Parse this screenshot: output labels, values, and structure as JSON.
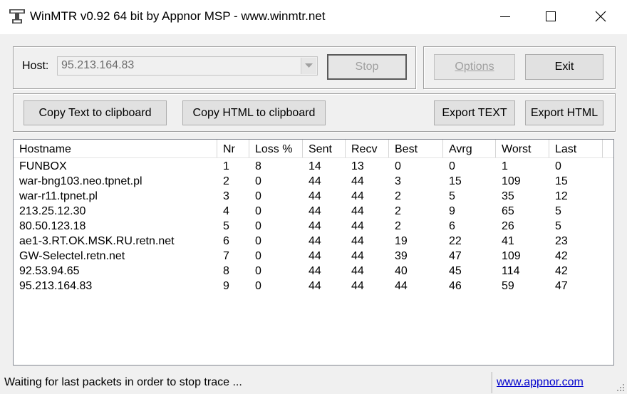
{
  "window": {
    "title": "WinMTR v0.92 64 bit by Appnor MSP - www.winmtr.net",
    "icon": "winmtr-app-icon"
  },
  "host": {
    "label": "Host:",
    "value": "95.213.164.83"
  },
  "buttons": {
    "stop": "Stop",
    "options": "Options",
    "exit": "Exit",
    "copy_text": "Copy Text to clipboard",
    "copy_html": "Copy HTML to clipboard",
    "export_text": "Export TEXT",
    "export_html": "Export HTML"
  },
  "table": {
    "columns": [
      "Hostname",
      "Nr",
      "Loss %",
      "Sent",
      "Recv",
      "Best",
      "Avrg",
      "Worst",
      "Last"
    ],
    "rows": [
      [
        "FUNBOX",
        "1",
        "8",
        "14",
        "13",
        "0",
        "0",
        "1",
        "0"
      ],
      [
        "war-bng103.neo.tpnet.pl",
        "2",
        "0",
        "44",
        "44",
        "3",
        "15",
        "109",
        "15"
      ],
      [
        "war-r11.tpnet.pl",
        "3",
        "0",
        "44",
        "44",
        "2",
        "5",
        "35",
        "12"
      ],
      [
        "213.25.12.30",
        "4",
        "0",
        "44",
        "44",
        "2",
        "9",
        "65",
        "5"
      ],
      [
        "80.50.123.18",
        "5",
        "0",
        "44",
        "44",
        "2",
        "6",
        "26",
        "5"
      ],
      [
        "ae1-3.RT.OK.MSK.RU.retn.net",
        "6",
        "0",
        "44",
        "44",
        "19",
        "22",
        "41",
        "23"
      ],
      [
        "GW-Selectel.retn.net",
        "7",
        "0",
        "44",
        "44",
        "39",
        "47",
        "109",
        "42"
      ],
      [
        "92.53.94.65",
        "8",
        "0",
        "44",
        "44",
        "40",
        "45",
        "114",
        "42"
      ],
      [
        "95.213.164.83",
        "9",
        "0",
        "44",
        "44",
        "44",
        "46",
        "59",
        "47"
      ]
    ]
  },
  "status": {
    "text": "Waiting for last packets in order to stop trace ...",
    "link": "www.appnor.com"
  }
}
